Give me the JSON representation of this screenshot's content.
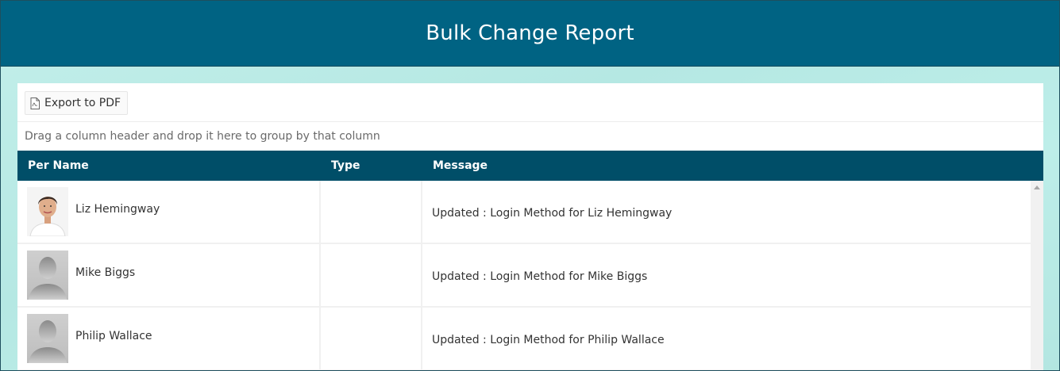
{
  "header": {
    "title": "Bulk Change Report"
  },
  "toolbar": {
    "export_label": "Export to PDF",
    "export_icon": "pdf-file-icon"
  },
  "grid": {
    "group_hint": "Drag a column header and drop it here to group by that column",
    "columns": [
      "Per Name",
      "Type",
      "Message"
    ],
    "rows": [
      {
        "name": "Liz Hemingway",
        "type": "",
        "message": "Updated : Login Method for Liz Hemingway",
        "avatar": "photo"
      },
      {
        "name": "Mike Biggs",
        "type": "",
        "message": "Updated : Login Method for Mike Biggs",
        "avatar": "placeholder"
      },
      {
        "name": "Philip Wallace",
        "type": "",
        "message": "Updated : Login Method for Philip Wallace",
        "avatar": "placeholder"
      }
    ]
  },
  "colors": {
    "header_bg": "#006383",
    "grid_header_bg": "#004e68",
    "page_bg": "#b9ebe6"
  }
}
